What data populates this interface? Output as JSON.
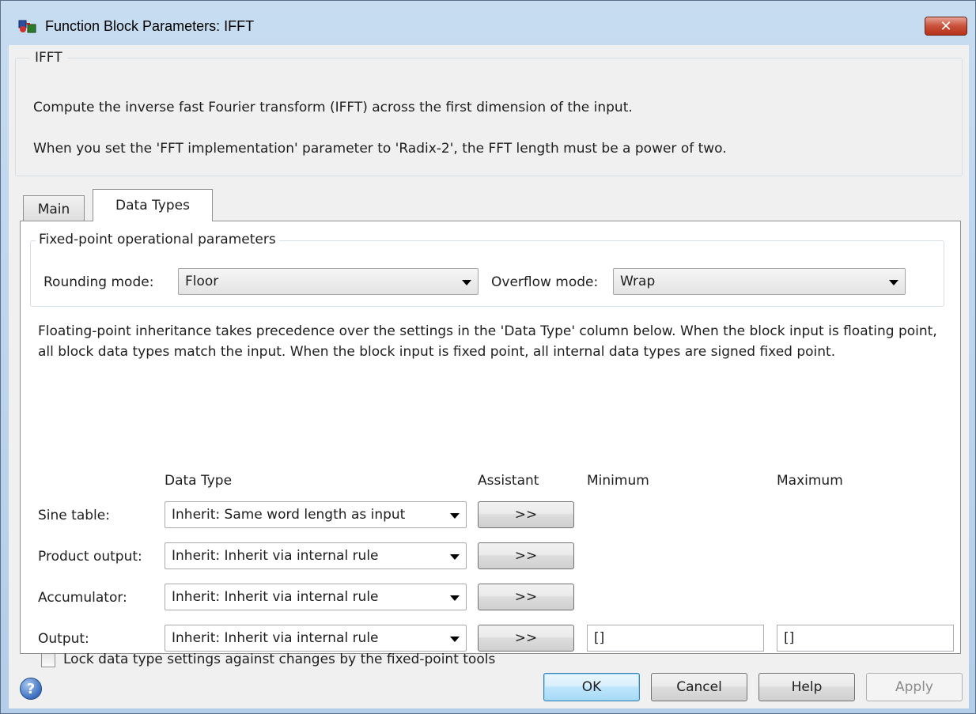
{
  "window": {
    "title": "Function Block Parameters: IFFT",
    "close_glyph": "✕"
  },
  "description": {
    "group_title": "IFFT",
    "line1": "Compute the inverse fast Fourier transform (IFFT) across the first dimension of the input.",
    "line2": "When you set the 'FFT implementation' parameter to 'Radix-2', the FFT length must be a power of two."
  },
  "tabs": [
    {
      "label": "Main",
      "selected": false
    },
    {
      "label": "Data Types",
      "selected": true
    }
  ],
  "fixed_point": {
    "group_title": "Fixed-point operational parameters",
    "rounding_label": "Rounding mode:",
    "rounding_value": "Floor",
    "overflow_label": "Overflow mode:",
    "overflow_value": "Wrap"
  },
  "note": "Floating-point inheritance takes precedence over the settings in the 'Data Type' column below. When the block input is floating point, all block data types match the input. When the block input is fixed point, all internal data types are signed fixed point.",
  "table": {
    "headers": {
      "data_type": "Data Type",
      "assistant": "Assistant",
      "minimum": "Minimum",
      "maximum": "Maximum"
    },
    "rows": [
      {
        "label": "Sine table:",
        "data_type": "Inherit: Same word length as input",
        "assistant": ">>"
      },
      {
        "label": "Product output:",
        "data_type": "Inherit: Inherit via internal rule",
        "assistant": ">>"
      },
      {
        "label": "Accumulator:",
        "data_type": "Inherit: Inherit via internal rule",
        "assistant": ">>"
      },
      {
        "label": "Output:",
        "data_type": "Inherit: Inherit via internal rule",
        "assistant": ">>",
        "minimum": "[]",
        "maximum": "[]"
      }
    ]
  },
  "lock": {
    "label": "Lock data type settings against changes by the fixed-point tools",
    "checked": false
  },
  "buttons": {
    "help_icon": "?",
    "ok": "OK",
    "cancel": "Cancel",
    "help": "Help",
    "apply": "Apply"
  },
  "colors": {
    "title_bar": "#c7dcf0",
    "close_button": "#c9503a",
    "ok_button_accent": "#3c7fb1"
  }
}
